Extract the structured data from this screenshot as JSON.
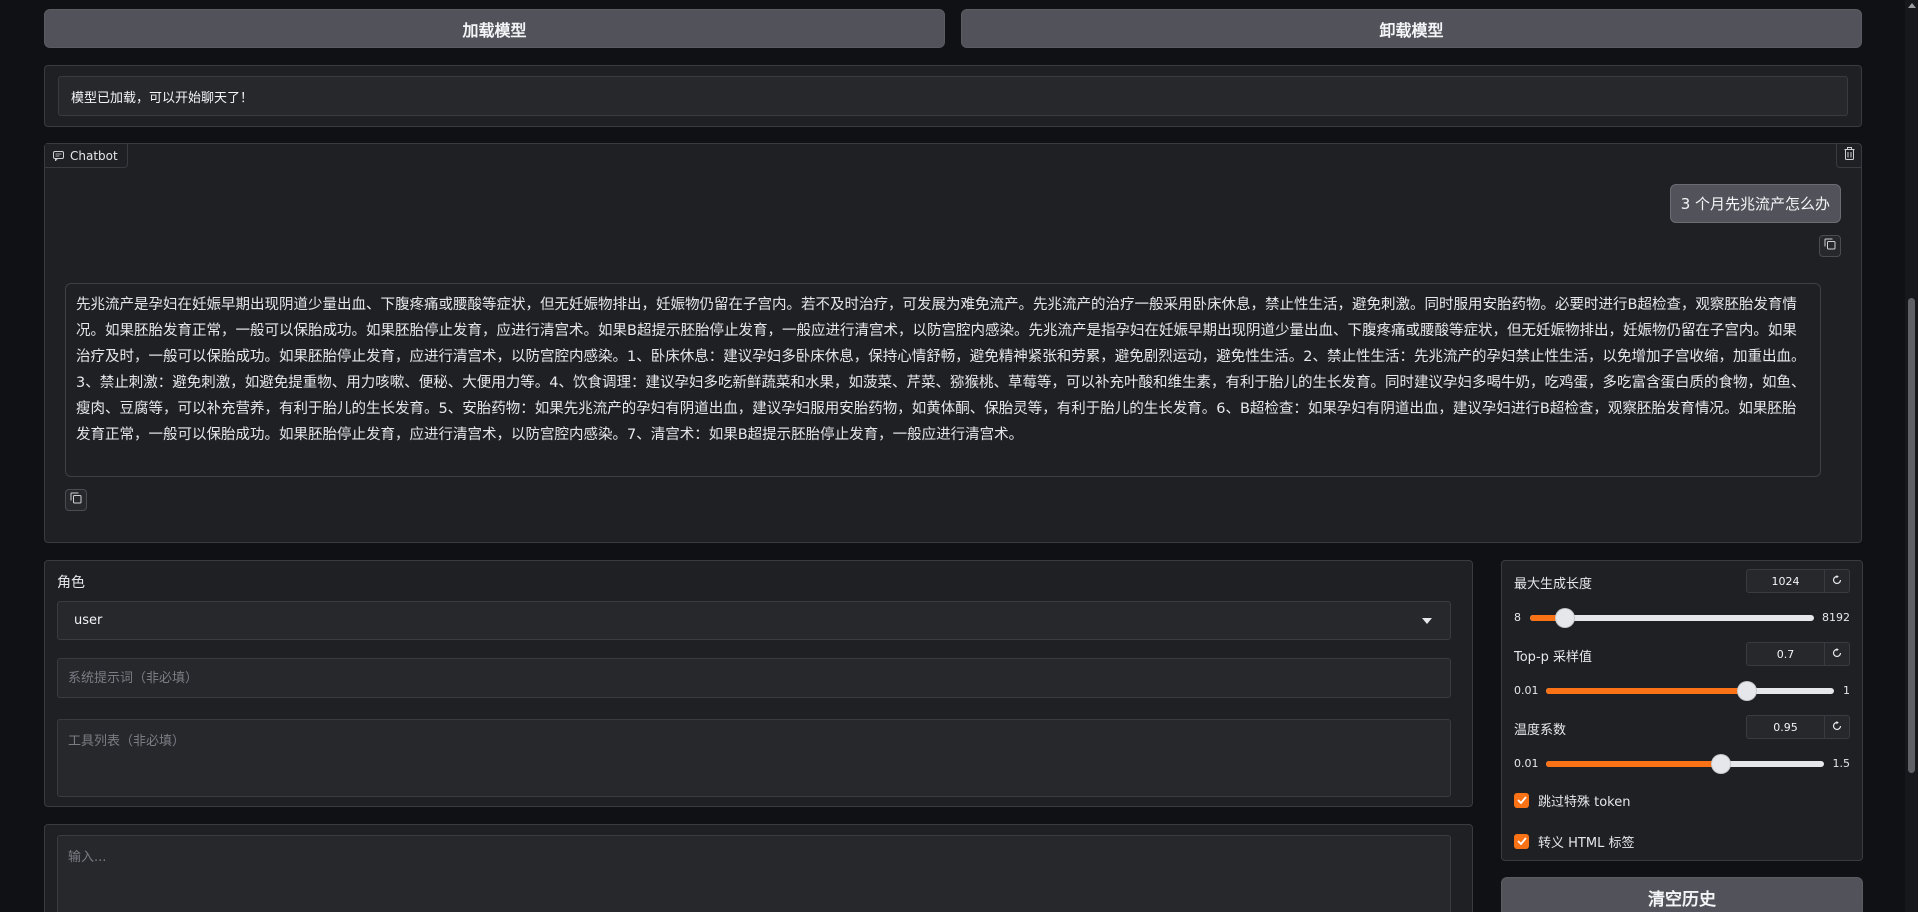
{
  "top_buttons": {
    "load_model": "加载模型",
    "unload_model": "卸载模型"
  },
  "status": {
    "message": "模型已加载，可以开始聊天了！"
  },
  "chatbot": {
    "label": "Chatbot",
    "label_icon": "chat-bubble-icon",
    "clear_icon": "trash-icon",
    "messages": [
      {
        "role": "user",
        "text": "3 个月先兆流产怎么办"
      },
      {
        "role": "assistant",
        "text": "先兆流产是孕妇在妊娠早期出现阴道少量出血、下腹疼痛或腰酸等症状，但无妊娠物排出，妊娠物仍留在子宫内。若不及时治疗，可发展为难免流产。先兆流产的治疗一般采用卧床休息，禁止性生活，避免刺激。同时服用安胎药物。必要时进行B超检查，观察胚胎发育情况。如果胚胎发育正常，一般可以保胎成功。如果胚胎停止发育，应进行清宫术。如果B超提示胚胎停止发育，一般应进行清宫术，以防宫腔内感染。先兆流产是指孕妇在妊娠早期出现阴道少量出血、下腹疼痛或腰酸等症状，但无妊娠物排出，妊娠物仍留在子宫内。如果治疗及时，一般可以保胎成功。如果胚胎停止发育，应进行清宫术，以防宫腔内感染。1、卧床休息：建议孕妇多卧床休息，保持心情舒畅，避免精神紧张和劳累，避免剧烈运动，避免性生活。2、禁止性生活：先兆流产的孕妇禁止性生活，以免增加子宫收缩，加重出血。3、禁止刺激：避免刺激，如避免提重物、用力咳嗽、便秘、大便用力等。4、饮食调理：建议孕妇多吃新鲜蔬菜和水果，如菠菜、芹菜、猕猴桃、草莓等，可以补充叶酸和维生素，有利于胎儿的生长发育。同时建议孕妇多喝牛奶，吃鸡蛋，多吃富含蛋白质的食物，如鱼、瘦肉、豆腐等，可以补充营养，有利于胎儿的生长发育。5、安胎药物：如果先兆流产的孕妇有阴道出血，建议孕妇服用安胎药物，如黄体酮、保胎灵等，有利于胎儿的生长发育。6、B超检查：如果孕妇有阴道出血，建议孕妇进行B超检查，观察胚胎发育情况。如果胚胎发育正常，一般可以保胎成功。如果胚胎停止发育，应进行清宫术，以防宫腔内感染。7、清宫术：如果B超提示胚胎停止发育，一般应进行清宫术。"
      }
    ],
    "copy_icon": "copy-icon"
  },
  "input_panel": {
    "role_label": "角色",
    "role_value": "user",
    "system_prompt_placeholder": "系统提示词（非必填）",
    "tools_placeholder": "工具列表（非必填）",
    "message_placeholder": "输入..."
  },
  "settings": {
    "max_new_tokens": {
      "label": "最大生成长度",
      "value": "1024",
      "min": "8",
      "max": "8192",
      "fraction": 0.124
    },
    "top_p": {
      "label": "Top-p 采样值",
      "value": "0.7",
      "min": "0.01",
      "max": "1",
      "fraction": 0.697
    },
    "temperature": {
      "label": "温度系数",
      "value": "0.95",
      "min": "0.01",
      "max": "1.5",
      "fraction": 0.631
    },
    "skip_special_tokens": {
      "label": "跳过特殊 token",
      "checked": true
    },
    "escape_html": {
      "label": "转义 HTML 标签",
      "checked": true
    },
    "reset_icon": "reset-icon"
  },
  "clear_history": {
    "label": "清空历史"
  },
  "colors": {
    "accent": "#f97316",
    "background": "#0f1115",
    "panel": "#1f2023",
    "button": "#52525b"
  }
}
